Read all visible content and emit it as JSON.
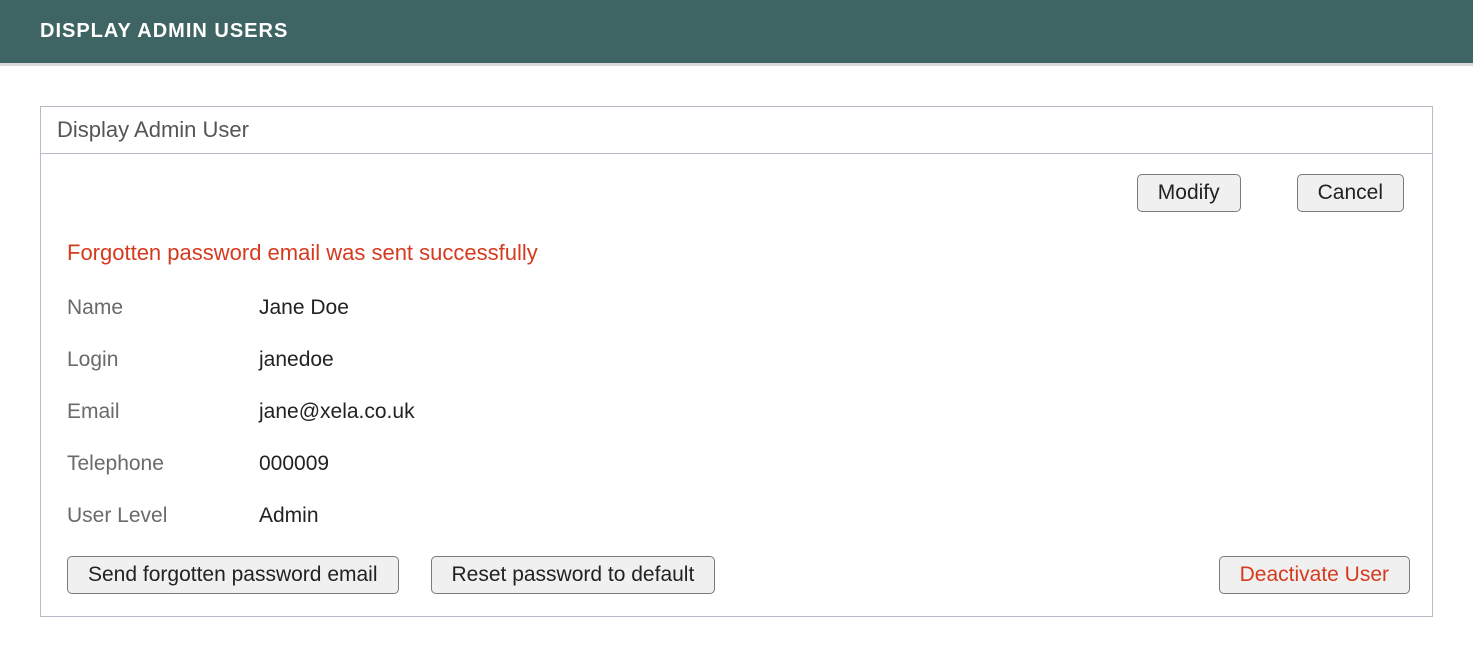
{
  "header": {
    "title": "DISPLAY ADMIN USERS"
  },
  "panel": {
    "title": "Display Admin User",
    "status_message": "Forgotten password email was sent successfully",
    "actions": {
      "modify": "Modify",
      "cancel": "Cancel",
      "send_forgotten_password": "Send forgotten password email",
      "reset_password": "Reset password to default",
      "deactivate_user": "Deactivate User"
    },
    "fields": {
      "name": {
        "label": "Name",
        "value": "Jane Doe"
      },
      "login": {
        "label": "Login",
        "value": "janedoe"
      },
      "email": {
        "label": "Email",
        "value": "jane@xela.co.uk"
      },
      "telephone": {
        "label": "Telephone",
        "value": "000009"
      },
      "user_level": {
        "label": "User Level",
        "value": "Admin"
      }
    }
  }
}
